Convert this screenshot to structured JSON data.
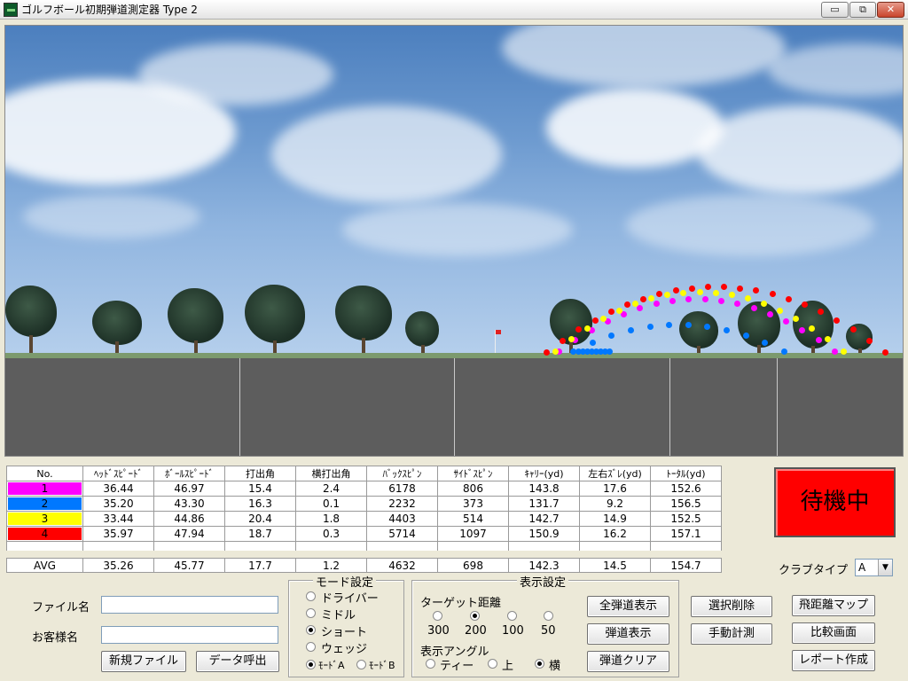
{
  "window": {
    "title": "ゴルフボール初期弾道測定器 Type 2",
    "controls": {
      "minimize": "▭",
      "restore": "⧉",
      "close": "✕"
    }
  },
  "scene": {
    "ball_colors": {
      "1": "#ff00ff",
      "2": "#0078ff",
      "3": "#ffff00",
      "4": "#ff0000"
    }
  },
  "table": {
    "headers": [
      "No.",
      "ﾍｯﾄﾞｽﾋﾟｰﾄﾞ",
      "ﾎﾞｰﾙｽﾋﾟｰﾄﾞ",
      "打出角",
      "横打出角",
      "ﾊﾞｯｸｽﾋﾟﾝ",
      "ｻｲﾄﾞｽﾋﾟﾝ",
      "ｷｬﾘｰ(yd)",
      "左右ｽﾞﾚ(yd)",
      "ﾄｰﾀﾙ(yd)"
    ],
    "rows": [
      {
        "no": "1",
        "color": "#ff00ff",
        "values": [
          "36.44",
          "46.97",
          "15.4",
          "2.4",
          "6178",
          "806",
          "143.8",
          "17.6",
          "152.6"
        ]
      },
      {
        "no": "2",
        "color": "#0078ff",
        "values": [
          "35.20",
          "43.30",
          "16.3",
          "0.1",
          "2232",
          "373",
          "131.7",
          "9.2",
          "156.5"
        ]
      },
      {
        "no": "3",
        "color": "#ffff00",
        "values": [
          "33.44",
          "44.86",
          "20.4",
          "1.8",
          "4403",
          "514",
          "142.7",
          "14.9",
          "152.5"
        ]
      },
      {
        "no": "4",
        "color": "#ff0000",
        "values": [
          "35.97",
          "47.94",
          "18.7",
          "0.3",
          "5714",
          "1097",
          "150.9",
          "16.2",
          "157.1"
        ]
      }
    ],
    "avg": {
      "label": "AVG",
      "values": [
        "35.26",
        "45.77",
        "17.7",
        "1.2",
        "4632",
        "698",
        "142.3",
        "14.5",
        "154.7"
      ]
    }
  },
  "status": {
    "text": "待機中",
    "color": "#ff0000"
  },
  "club_type": {
    "label": "クラブタイプ",
    "value": "A"
  },
  "file": {
    "filename_label": "ファイル名",
    "filename_value": "",
    "customer_label": "お客様名",
    "customer_value": "",
    "new_file_button": "新規ファイル",
    "load_data_button": "データ呼出"
  },
  "mode": {
    "title": "モード設定",
    "options": [
      {
        "label": "ドライバー",
        "selected": false
      },
      {
        "label": "ミドル",
        "selected": false
      },
      {
        "label": "ショート",
        "selected": true
      },
      {
        "label": "ウェッジ",
        "selected": false
      }
    ],
    "mode_a": "ﾓｰﾄﾞA",
    "mode_b": "ﾓｰﾄﾞB",
    "mode_selected": "A"
  },
  "display": {
    "title": "表示設定",
    "target_label": "ターゲット距離",
    "targets": [
      {
        "label": "300",
        "selected": false
      },
      {
        "label": "200",
        "selected": true
      },
      {
        "label": "100",
        "selected": false
      },
      {
        "label": "50",
        "selected": false
      }
    ],
    "angle_label": "表示アングル",
    "angles": [
      {
        "label": "ティー",
        "selected": false
      },
      {
        "label": "上",
        "selected": false
      },
      {
        "label": "横",
        "selected": true
      }
    ]
  },
  "buttons": {
    "show_all": "全弾道表示",
    "show_trajectory": "弾道表示",
    "clear_trajectory": "弾道クリア",
    "delete_selected": "選択削除",
    "manual_measure": "手動計測",
    "distance_map": "飛距離マップ",
    "compare_screen": "比較画面",
    "create_report": "レポート作成"
  }
}
